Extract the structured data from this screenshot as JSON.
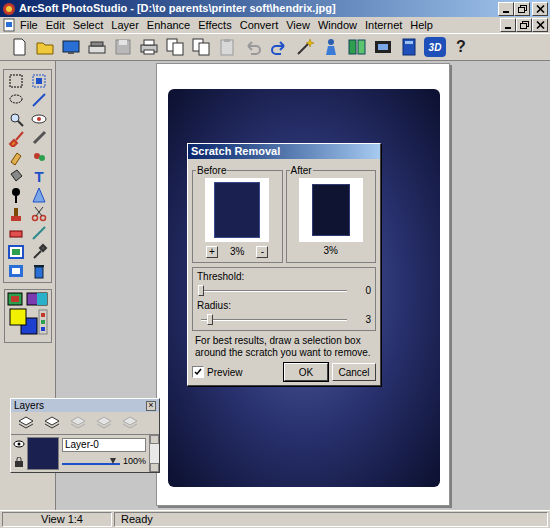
{
  "window": {
    "title": "ArcSoft PhotoStudio - [D:\\to parents\\printer soft\\hendrix.jpg]"
  },
  "menu": [
    "File",
    "Edit",
    "Select",
    "Layer",
    "Enhance",
    "Effects",
    "Convert",
    "View",
    "Window",
    "Internet",
    "Help"
  ],
  "toolbar": {
    "three_d": "3D",
    "help": "?"
  },
  "tools": {
    "text_tool": "T"
  },
  "dialog": {
    "title": "Scratch Removal",
    "before": {
      "label": "Before",
      "zoom": "3%",
      "zoom_in": "+",
      "zoom_out": "-"
    },
    "after": {
      "label": "After",
      "zoom": "3%"
    },
    "sliders": [
      {
        "label": "Threshold:",
        "value": "0",
        "level": 0
      },
      {
        "label": "Radius:",
        "value": "3",
        "level": 0.06
      }
    ],
    "hint": "For best results, draw a selection box around the scratch you want to remove.",
    "preview": {
      "label": "Preview",
      "checked": true
    },
    "buttons": [
      {
        "label": "OK",
        "default": true
      },
      {
        "label": "Cancel",
        "default": false
      }
    ]
  },
  "layers": {
    "title": "Layers",
    "close": "×",
    "layer": {
      "name": "Layer-0",
      "opacity": "100%",
      "level": 0.88,
      "visible": true
    }
  },
  "status_bar": {
    "view": "View 1:4",
    "status": "Ready"
  }
}
